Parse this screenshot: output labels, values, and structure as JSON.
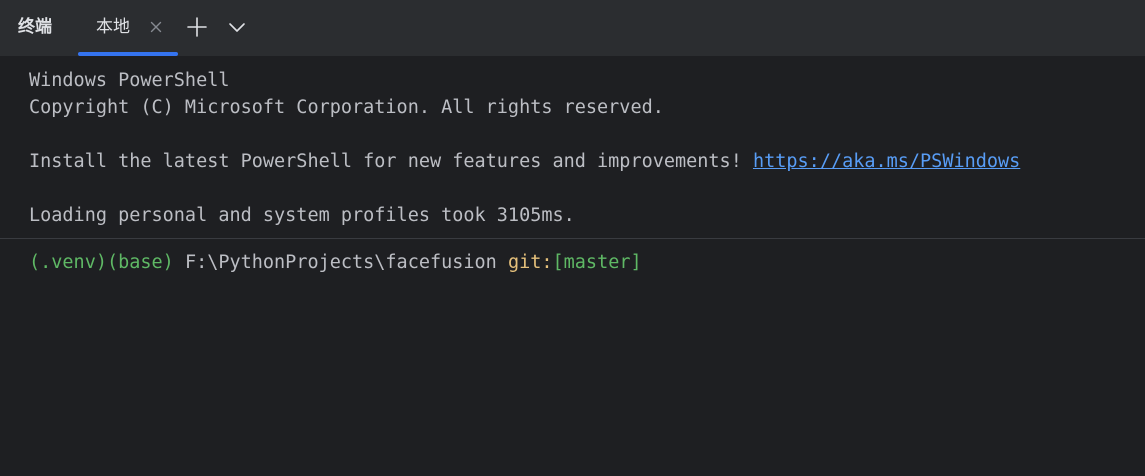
{
  "panel": {
    "title": "终端"
  },
  "tabs": [
    {
      "label": "本地",
      "active": true
    }
  ],
  "icons": {
    "close": "close-icon",
    "new_tab": "plus-icon",
    "dropdown": "chevron-down-icon"
  },
  "terminal": {
    "line1": "Windows PowerShell",
    "line2": "Copyright (C) Microsoft Corporation. All rights reserved.",
    "line3_text": "Install the latest PowerShell for new features and improvements! ",
    "line3_link": "https://aka.ms/PSWindows",
    "line4": "Loading personal and system profiles took 3105ms.",
    "prompt": {
      "env": "(.venv)(base)",
      "path": "F:\\PythonProjects\\facefusion",
      "git_label": "git:",
      "branch": "[master]"
    }
  },
  "colors": {
    "background": "#1e1f22",
    "tabbar": "#2b2d30",
    "accent": "#3574f0",
    "link": "#589df6",
    "venv": "#5fb865",
    "git": "#e5c07b",
    "text": "#bcbec4"
  }
}
